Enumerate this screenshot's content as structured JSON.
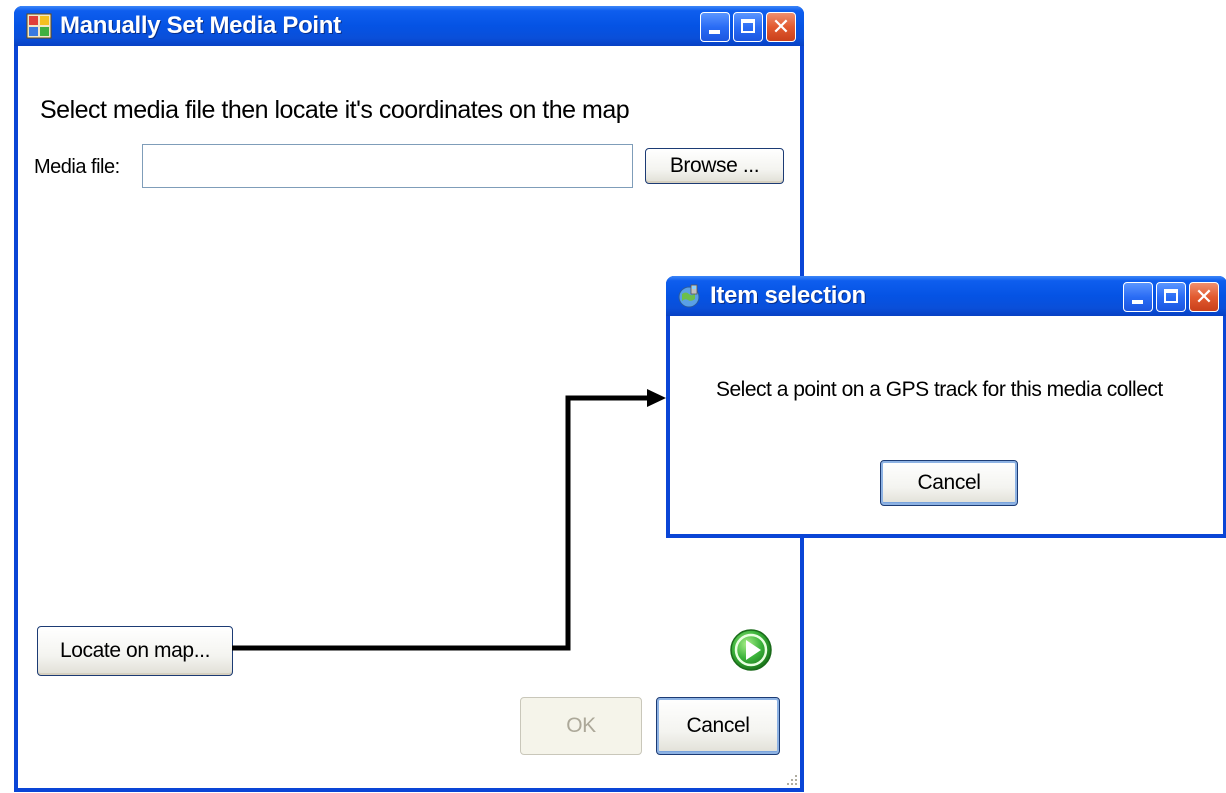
{
  "main_window": {
    "title": "Manually Set Media Point",
    "instruction": "Select media file then locate it's coordinates on the map",
    "media_file_label": "Media file:",
    "media_file_value": "",
    "browse_label": "Browse ...",
    "locate_label": "Locate on map...",
    "ok_label": "OK",
    "cancel_label": "Cancel",
    "icons": {
      "app": "app-window-icon",
      "go": "green-play-icon",
      "grip": "resize-grip-icon"
    }
  },
  "item_dialog": {
    "title": "Item selection",
    "message": "Select a point on a GPS track for this media collect",
    "cancel_label": "Cancel",
    "icons": {
      "app": "globe-gps-icon"
    }
  },
  "colors": {
    "titlebar": "#0553e4",
    "frame": "#0a45d6",
    "close_button": "#e25a30",
    "go_icon": "#2faa2f",
    "arrow": "#000000"
  }
}
